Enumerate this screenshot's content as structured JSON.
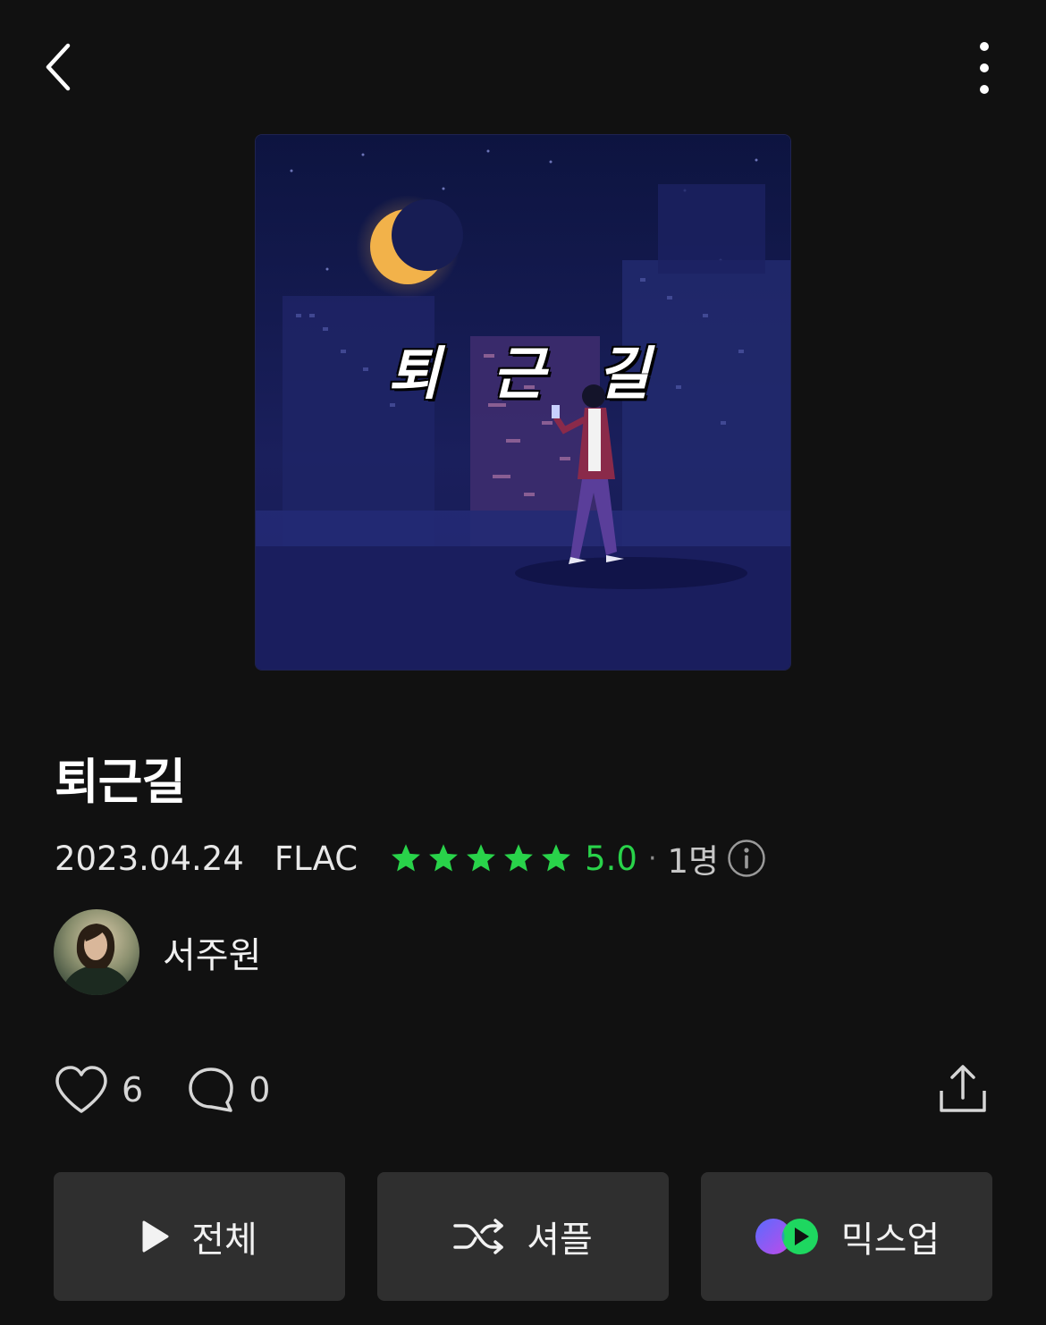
{
  "header": {
    "back_icon": "chevron-left-icon",
    "more_icon": "more-vertical-icon"
  },
  "album": {
    "cover_text": "퇴 근 길",
    "title": "퇴근길",
    "release_date": "2023.04.24",
    "format": "FLAC",
    "rating": "5.0",
    "rating_stars": 5,
    "rating_separator": "·",
    "rating_count": "1명",
    "star_color": "#29d34a"
  },
  "artist": {
    "name": "서주원"
  },
  "social": {
    "likes": "6",
    "comments": "0"
  },
  "actions": {
    "play_all": "전체",
    "shuffle": "셔플",
    "mixup": "믹스업"
  },
  "colors": {
    "background": "#111111",
    "button_bg": "#2f2f2f",
    "accent_green": "#29d34a"
  }
}
